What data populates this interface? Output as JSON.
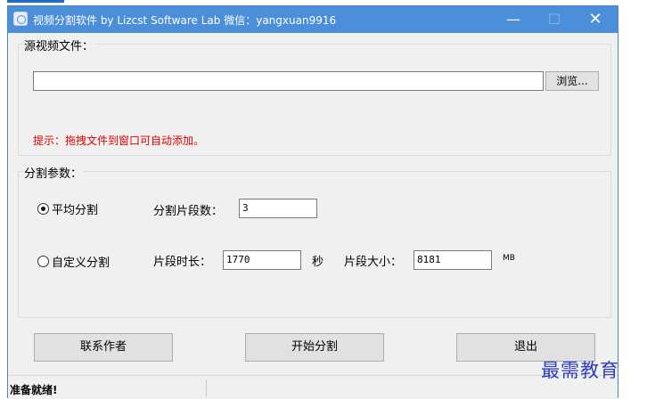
{
  "window": {
    "title": "视频分割软件  by Lizcst Software Lab  微信：yangxuan9916",
    "min_glyph": "—",
    "max_glyph": "☐",
    "close_glyph": "✕"
  },
  "source_group": {
    "legend": "源视频文件：",
    "file_path_value": "",
    "browse_label": "浏览...",
    "hint": "提示：拖拽文件到窗口可自动添加。",
    "hint_color": "#e00000"
  },
  "params_group": {
    "legend": "分割参数：",
    "radio_average": {
      "label": "平均分割",
      "checked": true
    },
    "segment_count_label": "分割片段数：",
    "segment_count_value": "3",
    "radio_custom": {
      "label": "自定义分割",
      "checked": false
    },
    "segment_duration_label": "片段时长：",
    "segment_duration_value": "1770",
    "seconds_unit": "秒",
    "segment_size_label": "片段大小：",
    "segment_size_value": "8181",
    "mb_unit": "MB"
  },
  "buttons": {
    "contact_author": "联系作者",
    "start_split": "开始分割",
    "exit": "退出"
  },
  "status": {
    "text": "准备就绪!"
  },
  "watermark": "最需教育",
  "colors": {
    "titlebar": "#4b8fdb",
    "accent": "#1c6ccf"
  }
}
